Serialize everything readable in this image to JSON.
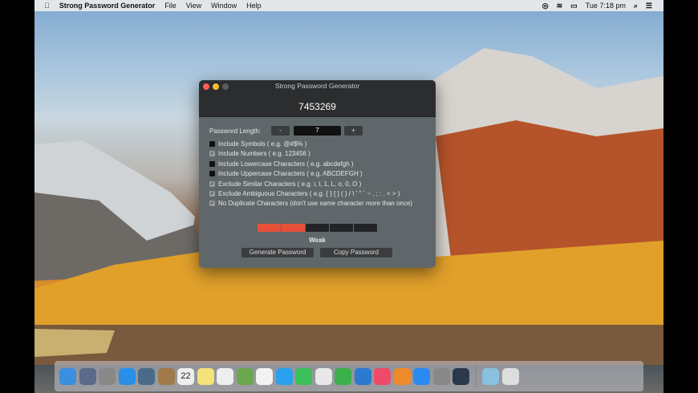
{
  "menubar": {
    "app": "Strong Password Generator",
    "items": [
      "File",
      "View",
      "Window",
      "Help"
    ],
    "time": "Tue 7:18 pm"
  },
  "window": {
    "title": "Strong Password Generator",
    "password": "7453269",
    "length_label": "Password Length:",
    "minus": "-",
    "length": "7",
    "plus": "+",
    "options": [
      {
        "label": "Include Symbols ( e.g. @#$% )",
        "checked": false
      },
      {
        "label": "Include Numbers ( e.g. 123456 )",
        "checked": true
      },
      {
        "label": "Include Lowercase Characters ( e.g. abcdefgh )",
        "checked": false
      },
      {
        "label": "Include Uppercase Characters ( e.g. ABCDEFGH )",
        "checked": false
      },
      {
        "label": "Exclude Similar Characters ( e.g. i, l, 1, L, o, 0, O )",
        "checked": true
      },
      {
        "label": "Exclude Ambiguous Characters ( e.g. { } [ ] ( ) / \\ ' \" ` ~ , ; : . < > )",
        "checked": true
      },
      {
        "label": "No Duplicate Characters (don't use same character more than once)",
        "checked": true
      }
    ],
    "strength": {
      "label": "Weak",
      "filled_segments": 2,
      "total_segments": 5
    },
    "generate": "Generate Password",
    "copy": "Copy Password"
  },
  "dock": [
    "finder",
    "siri",
    "launchpad",
    "safari",
    "mail-photo",
    "notes-book",
    "calendar",
    "stickies",
    "reminders",
    "maps",
    "photos",
    "messages",
    "facetime",
    "pages",
    "numbers",
    "keynote",
    "itunes",
    "ibooks",
    "app-store",
    "system-preferences",
    "password-generator",
    "downloads-folder",
    "trash"
  ],
  "calendar_day": "22"
}
